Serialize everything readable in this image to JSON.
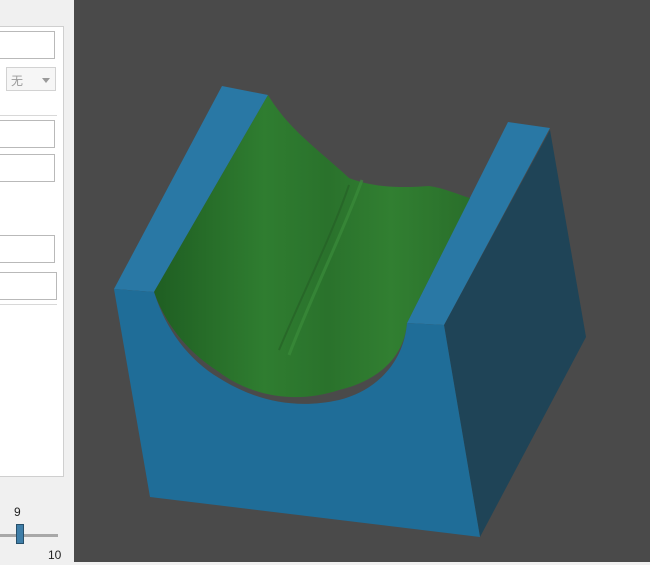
{
  "panel": {
    "combo_value": "无",
    "slider": {
      "label_top": "9",
      "label_bottom": "10",
      "value": 9
    }
  },
  "viewport": {
    "background": "#4a4a4a",
    "model": {
      "block_color": "#1f6d98",
      "side_color": "#1f4457",
      "channel_color": "#2e7d2e"
    }
  }
}
